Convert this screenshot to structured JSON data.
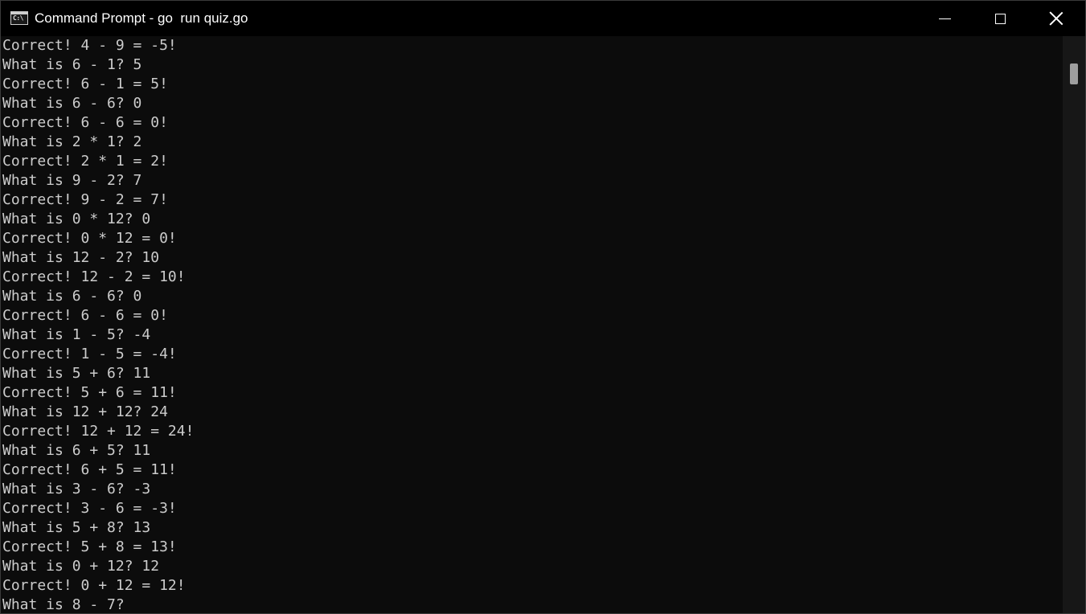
{
  "window": {
    "title": "Command Prompt - go  run quiz.go",
    "icon": "cmd-icon",
    "icon_glyph": "C:\\"
  },
  "controls": {
    "minimize": "minimize-icon",
    "maximize": "maximize-icon",
    "close": "close-icon"
  },
  "console": {
    "lines": [
      "Correct! 4 - 9 = -5!",
      "What is 6 - 1? 5",
      "Correct! 6 - 1 = 5!",
      "What is 6 - 6? 0",
      "Correct! 6 - 6 = 0!",
      "What is 2 * 1? 2",
      "Correct! 2 * 1 = 2!",
      "What is 9 - 2? 7",
      "Correct! 9 - 2 = 7!",
      "What is 0 * 12? 0",
      "Correct! 0 * 12 = 0!",
      "What is 12 - 2? 10",
      "Correct! 12 - 2 = 10!",
      "What is 6 - 6? 0",
      "Correct! 6 - 6 = 0!",
      "What is 1 - 5? -4",
      "Correct! 1 - 5 = -4!",
      "What is 5 + 6? 11",
      "Correct! 5 + 6 = 11!",
      "What is 12 + 12? 24",
      "Correct! 12 + 12 = 24!",
      "What is 6 + 5? 11",
      "Correct! 6 + 5 = 11!",
      "What is 3 - 6? -3",
      "Correct! 3 - 6 = -3!",
      "What is 5 + 8? 13",
      "Correct! 5 + 8 = 13!",
      "What is 0 + 12? 12",
      "Correct! 0 + 12 = 12!",
      "What is 8 - 7?"
    ]
  },
  "colors": {
    "background": "#0c0c0c",
    "titlebar": "#000000",
    "text": "#cccccc"
  }
}
